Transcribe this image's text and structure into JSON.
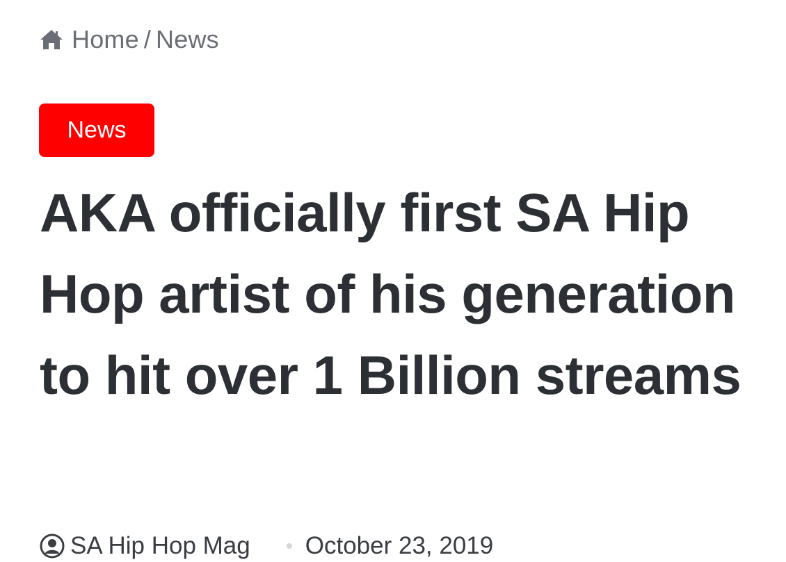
{
  "breadcrumb": {
    "home_icon": "home-icon",
    "home_label": "Home",
    "separator": "/",
    "current_label": "News"
  },
  "post": {
    "category": "News",
    "category_color": "#ff0000",
    "title": "AKA officially first SA Hip Hop artist of his generation to hit over 1 Billion streams",
    "author_icon": "user-circle-icon",
    "author": "SA Hip Hop Mag",
    "date": "October 23, 2019"
  }
}
